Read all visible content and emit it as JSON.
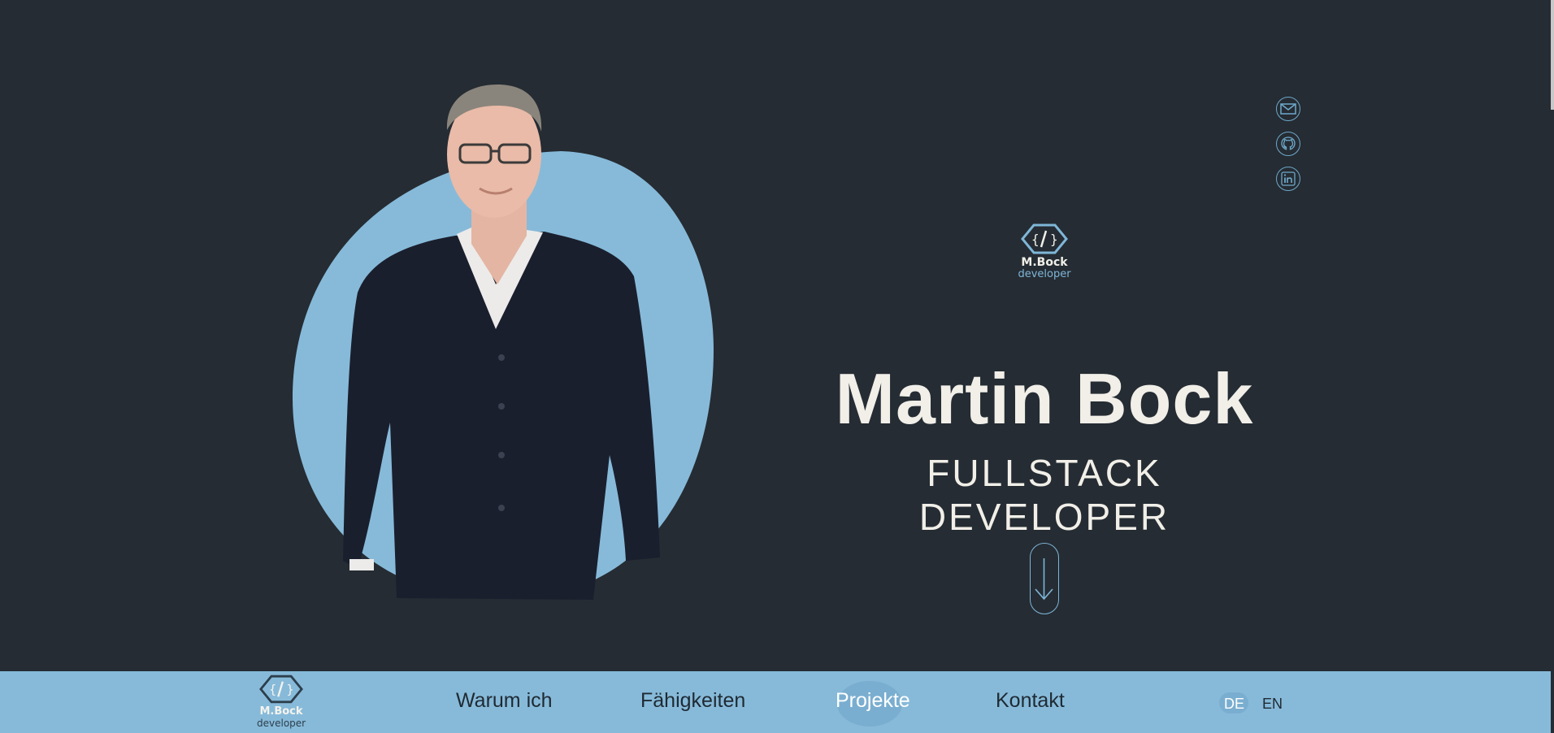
{
  "brand": {
    "name": "M.Bock",
    "role": "developer"
  },
  "hero": {
    "name": "Martin Bock",
    "subtitle": "FULLSTACK DEVELOPER"
  },
  "social": [
    {
      "icon": "mail-icon"
    },
    {
      "icon": "github-icon"
    },
    {
      "icon": "linkedin-icon"
    }
  ],
  "nav": {
    "items": [
      {
        "label": "Warum ich",
        "active": false
      },
      {
        "label": "Fähigkeiten",
        "active": false
      },
      {
        "label": "Projekte",
        "active": true
      },
      {
        "label": "Kontakt",
        "active": false
      }
    ],
    "languages": [
      {
        "label": "DE",
        "active": true
      },
      {
        "label": "EN",
        "active": false
      }
    ]
  },
  "colors": {
    "background": "#252c33",
    "accent": "#87bad9",
    "text_light": "#f1efe8",
    "text_dark": "#1f2a33"
  }
}
